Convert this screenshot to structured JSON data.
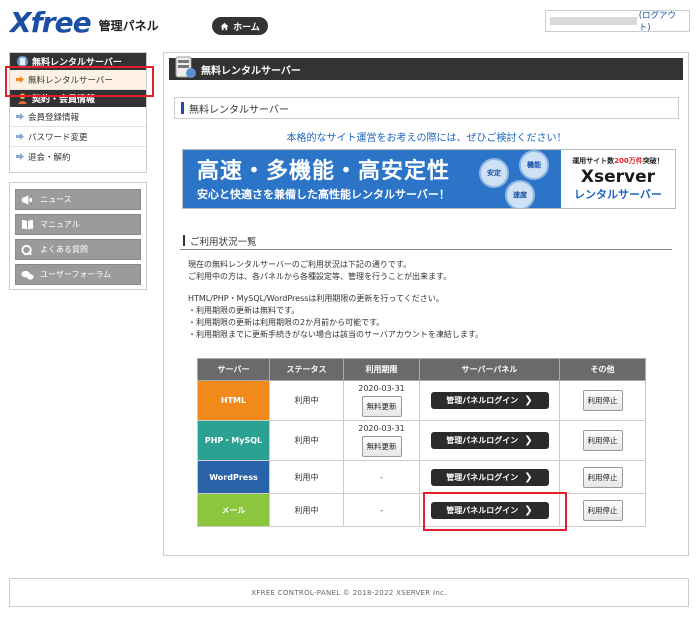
{
  "header": {
    "logo_text": "Xfree",
    "panel_title": "管理パネル",
    "home_label": "ホーム",
    "logout_label": "(ログアウト)"
  },
  "sidebar": {
    "section1_title": "無料レンタルサーバー",
    "section1_item": "無料レンタルサーバー",
    "section2_title": "契約・会員情報",
    "section2_items": [
      "会員登録情報",
      "パスワード変更",
      "退会・解約"
    ],
    "nav_items": [
      "ニュース",
      "マニュアル",
      "よくある質問",
      "ユーザーフォーラム"
    ]
  },
  "main": {
    "header_title": "無料レンタルサーバー",
    "section_title": "無料レンタルサーバー",
    "promo_text": "本格的なサイト運営をお考えの際には、ぜひご検討ください！",
    "banner": {
      "headline": "高速・多機能・高安定性",
      "subline": "安心と快適さを兼備した高性能レンタルサーバー！",
      "badge_1": "安定",
      "badge_2": "機能",
      "badge_3": "速度",
      "right_pre": "運用サイト数",
      "right_count": "200万件",
      "right_post": "突破！",
      "brand": "Xserver",
      "brand_sub": "レンタルサーバー"
    },
    "usage_title": "ご利用状況一覧",
    "desc_lines": [
      "現在の無料レンタルサーバーのご利用状況は下記の通りです。",
      "ご利用中の方は、各パネルから各種設定等、管理を行うことが出来ます。",
      "HTML/PHP・MySQL/WordPressは利用期限の更新を行ってください。",
      "・利用期限の更新は無料です。",
      "・利用期限の更新は利用期限の2か月前から可能です。",
      "・利用期限までに更新手続きがない場合は該当のサーバアカウントを凍結します。"
    ],
    "table": {
      "headers": [
        "サーバー",
        "ステータス",
        "利用期限",
        "サーバーパネル",
        "その他"
      ],
      "rows": [
        {
          "server": "HTML",
          "status": "利用中",
          "expiry": "2020-03-31",
          "renew": "無料更新",
          "login": "管理パネルログイン",
          "stop": "利用停止"
        },
        {
          "server": "PHP・MySQL",
          "status": "利用中",
          "expiry": "2020-03-31",
          "renew": "無料更新",
          "login": "管理パネルログイン",
          "stop": "利用停止"
        },
        {
          "server": "WordPress",
          "status": "利用中",
          "expiry": "-",
          "login": "管理パネルログイン",
          "stop": "利用停止"
        },
        {
          "server": "メール",
          "status": "利用中",
          "expiry": "-",
          "login": "管理パネルログイン",
          "stop": "利用停止"
        }
      ]
    }
  },
  "footer": {
    "text": "XFREE CONTROL-PANEL © 2018-2022 XSERVER Inc."
  },
  "colors": {
    "brand_blue": "#1b4fa6",
    "html": "#f28a1b",
    "php": "#2aa192",
    "wordpress": "#2a64a8",
    "mail": "#8cc63f",
    "highlight": "#e0202a"
  }
}
